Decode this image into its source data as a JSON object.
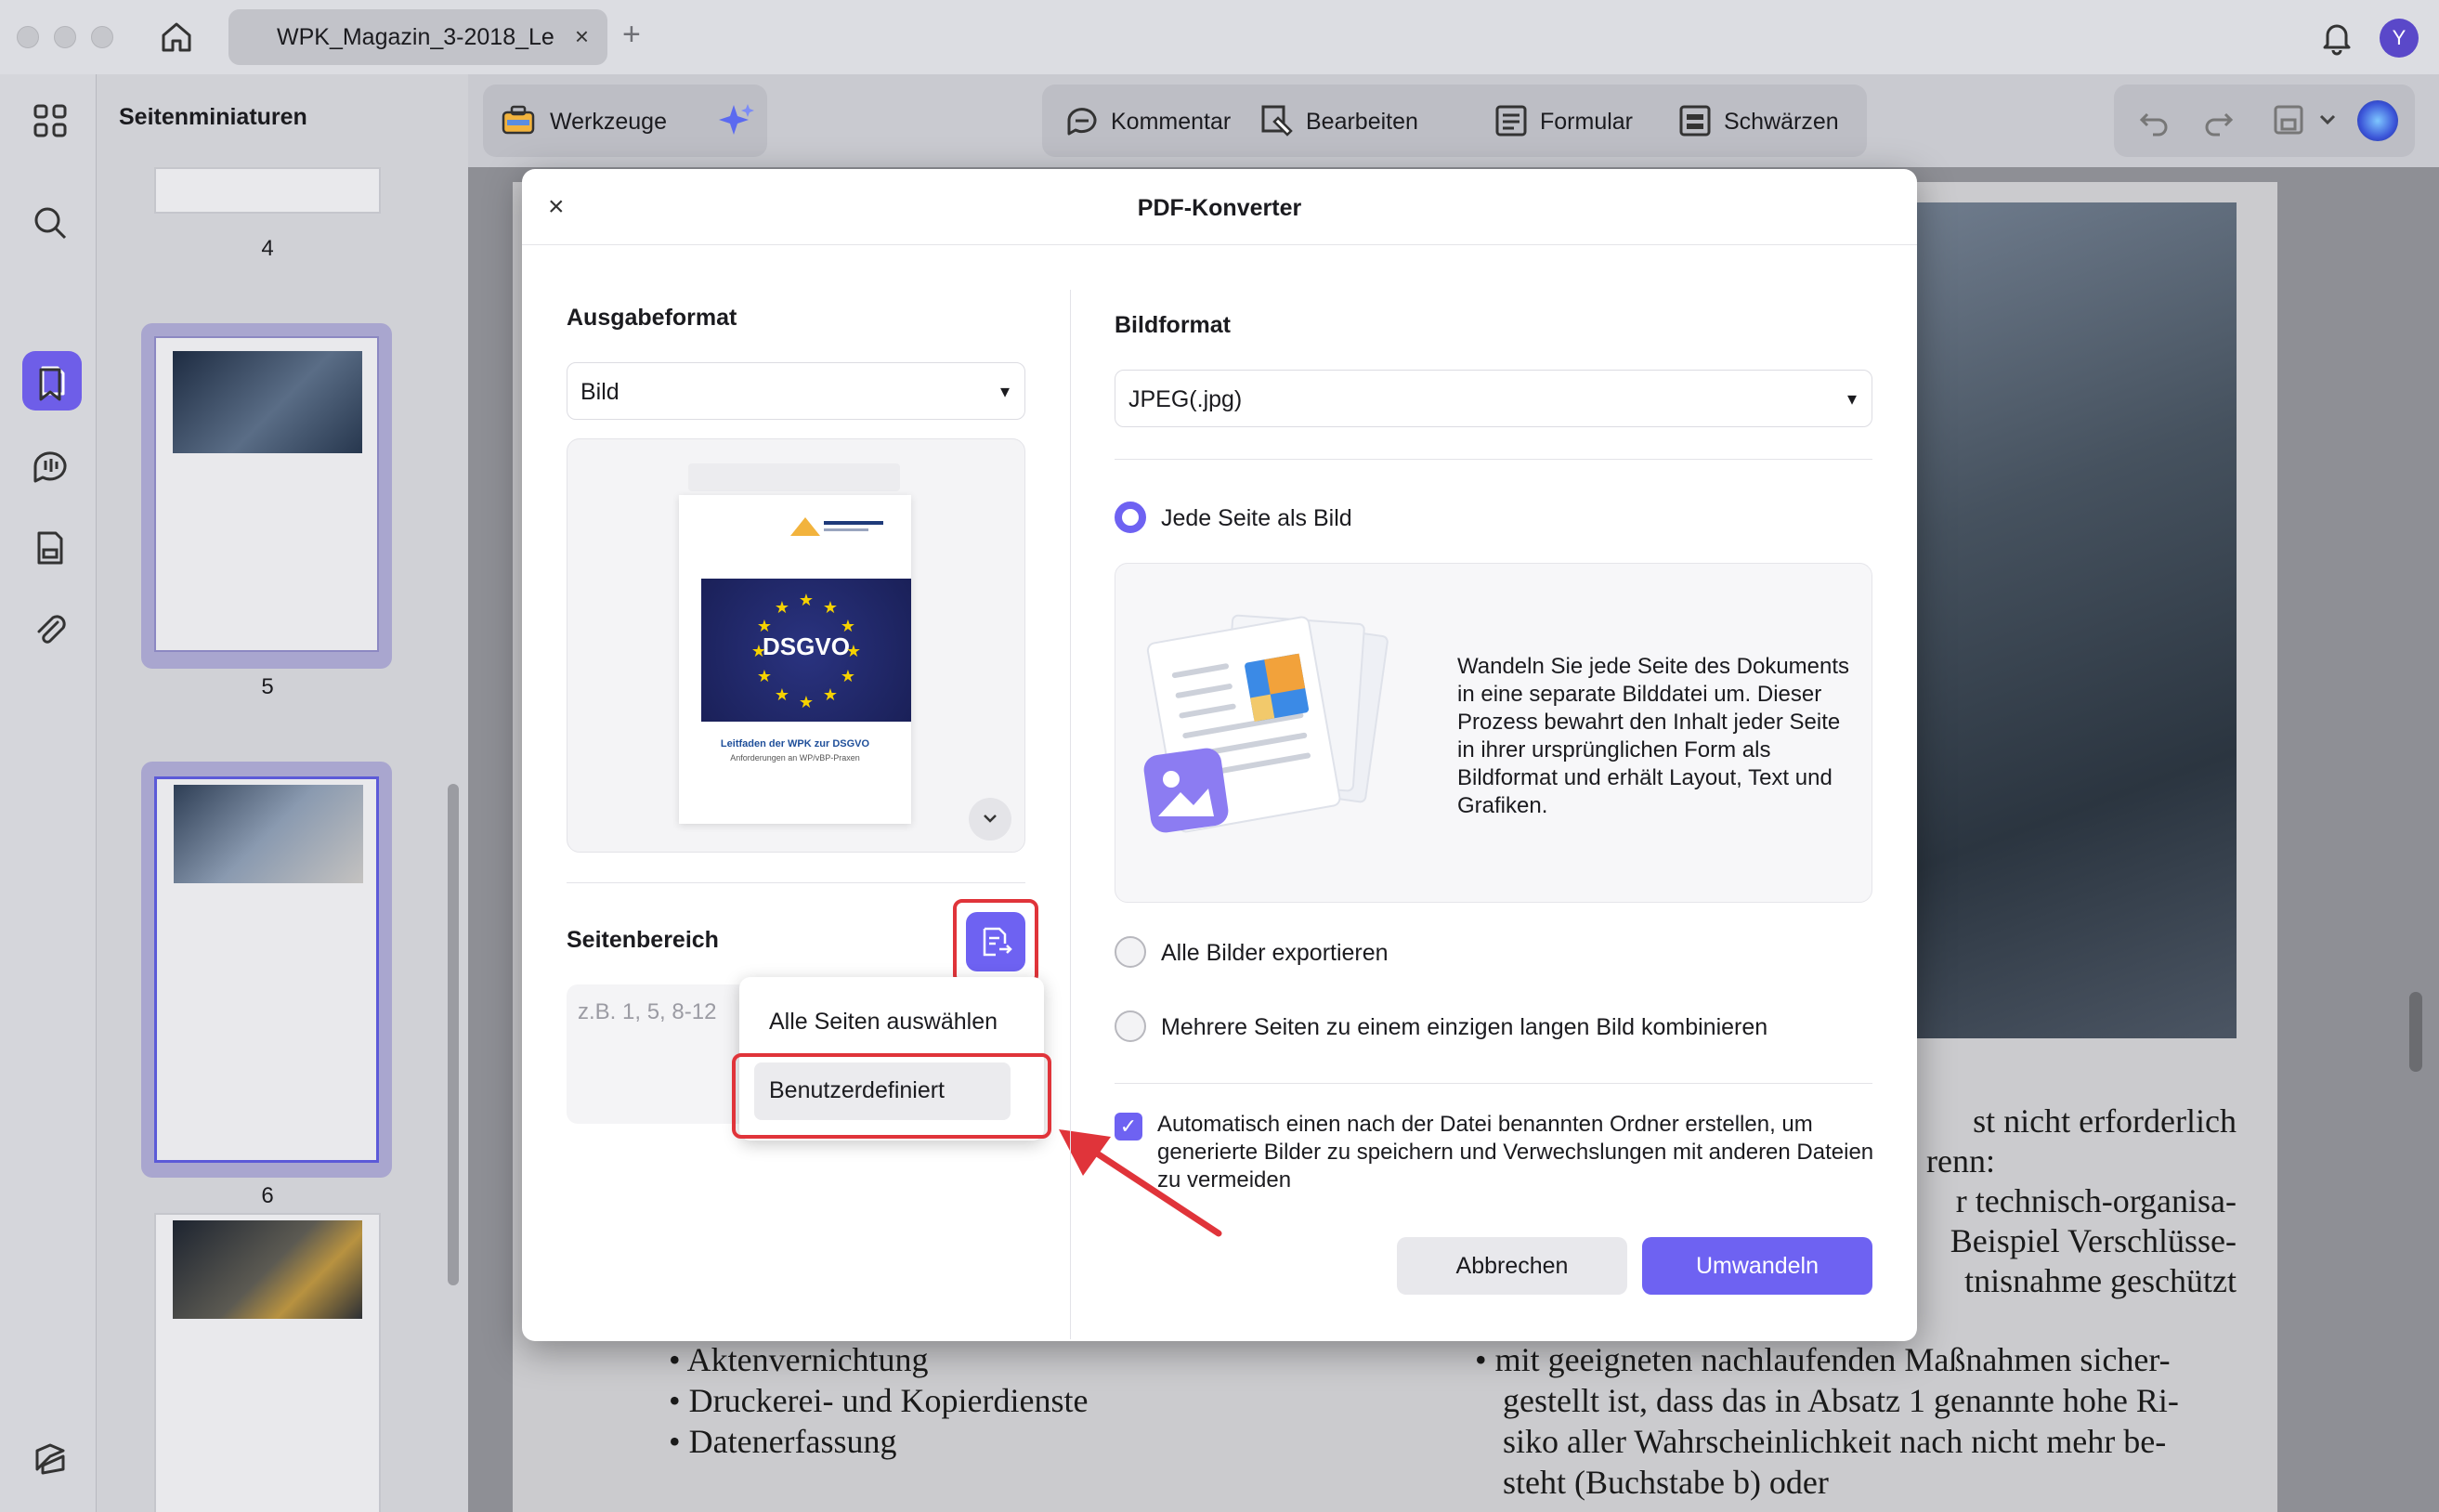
{
  "window": {
    "tab_title": "WPK_Magazin_3-2018_Le",
    "tab_close": "×",
    "tab_add": "+",
    "avatar_letter": "Y"
  },
  "sidebar": {
    "title": "Seitenminiaturen",
    "pages": [
      "4",
      "5",
      "6"
    ]
  },
  "toolbar": {
    "tools_label": "Werkzeuge",
    "comment_label": "Kommentar",
    "edit_label": "Bearbeiten",
    "form_label": "Formular",
    "redact_label": "Schwärzen"
  },
  "document": {
    "right_lines": [
      "st nicht erforderlich",
      "renn:",
      "r technisch-organisa-",
      "Beispiel Verschlüsse-",
      "tnisnahme geschützt"
    ],
    "left_bullets": [
      "Aktenvernichtung",
      "Druckerei- und Kopierdienste",
      "Datenerfassung"
    ],
    "right_bullet_lines": [
      "mit geeigneten nachlaufenden Maßnahmen sicher-",
      "gestellt ist, dass das in Absatz 1 genannte hohe Ri-",
      "siko aller Wahrscheinlichkeit nach nicht mehr be-",
      "steht (Buchstabe b) oder"
    ]
  },
  "modal": {
    "title": "PDF-Konverter",
    "close": "×",
    "output_format_label": "Ausgabeformat",
    "output_format_value": "Bild",
    "preview_caption_title": "Leitfaden der WPK zur DSGVO",
    "preview_caption_sub": "Anforderungen an WP/vBP-Praxen",
    "preview_banner": "DSGVO",
    "page_range_label": "Seitenbereich",
    "page_range_placeholder": "z.B. 1, 5, 8-12",
    "image_format_label": "Bildformat",
    "image_format_value": "JPEG(.jpg)",
    "options": [
      {
        "label": "Jede Seite als Bild",
        "selected": true
      },
      {
        "label": "Alle Bilder exportieren",
        "selected": false
      },
      {
        "label": "Mehrere Seiten zu einem einzigen langen Bild kombinieren",
        "selected": false
      }
    ],
    "description": "Wandeln Sie jede Seite des Dokuments in eine separate Bilddatei um. Dieser Prozess bewahrt den Inhalt jeder Seite in ihrer ursprünglichen Form als Bildformat und erhält Layout, Text und Grafiken.",
    "auto_folder_checked": true,
    "auto_folder_text": "Automatisch einen nach der Datei benannten Ordner erstellen, um generierte Bilder zu speichern und Verwechslungen mit anderen Dateien zu vermeiden",
    "cancel_label": "Abbrechen",
    "convert_label": "Umwandeln",
    "dropdown": {
      "items": [
        "Alle Seiten auswählen",
        "Benutzerdefiniert"
      ],
      "highlighted": "Benutzerdefiniert"
    }
  },
  "colors": {
    "accent": "#6e62f2",
    "highlight_red": "#e0343a"
  }
}
